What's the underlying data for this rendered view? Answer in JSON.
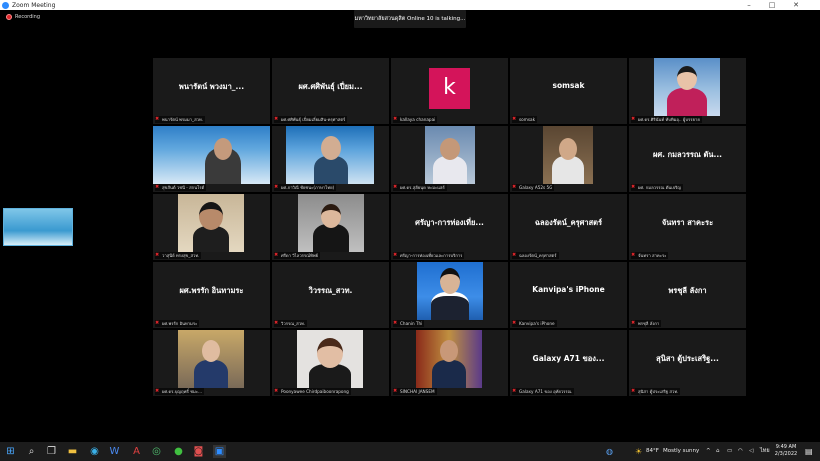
{
  "window": {
    "title": "Zoom Meeting",
    "controls": [
      "–",
      "□",
      "✕"
    ]
  },
  "recording_label": "Recording",
  "talking_banner": "มหาวิทยาลัยสวนดุสิต Online  10  is talking...",
  "tiles": [
    {
      "center_name": "พนารัตน์ พวงมา_...",
      "label": "พนารัตน์ พรมมา_สวท.",
      "muted": true
    },
    {
      "center_name": "ผศ.ศศิพันธุ์ เปี่ยม...",
      "label": "ผศ.ศศิพันธุ์ เปี่ยมเลี่ยมสิน-ครุศาสตร์",
      "muted": true
    },
    {
      "center_name": "",
      "label": "kallaya chanapai",
      "muted": true,
      "avatar_letter": "k",
      "avatar_color": "#d4145a"
    },
    {
      "center_name": "somsak",
      "label": "somsak",
      "muted": true
    },
    {
      "center_name": "",
      "label": "ผศ.ดร.ศิรินันท์ ทับทิมอุ.. ผู้บรรยาย",
      "muted": true
    },
    {
      "center_name": "",
      "label": "สุขสันต์ วชนี - สกนโรต์",
      "muted": true
    },
    {
      "center_name": "",
      "label": "ผศ.ภาวิณี ชัยชนะ(ภาษาไทย)",
      "muted": true
    },
    {
      "center_name": "",
      "label": "ผศ.ดร.สุฮัยนุด หะมะแฮร์",
      "muted": true
    },
    {
      "center_name": "",
      "label": "Galaxy A52s 5G",
      "muted": true
    },
    {
      "center_name": "ผศ. กมลวรรณ ตัน...",
      "label": "ผศ. กมลวรรณ ตันเจริญ",
      "muted": true
    },
    {
      "center_name": "",
      "label": "วาสุนีย์ ทรงสุข_สวท.",
      "muted": true
    },
    {
      "center_name": "",
      "label": "ศรีดา วิไลวรรณ์ทิพย์",
      "muted": true
    },
    {
      "center_name": "ศรัญา-การท่องเที่ย...",
      "label": "ศรัญา-การท่องเที่ยวและการบริการ",
      "muted": true
    },
    {
      "center_name": "ฉลองรัตน์_ครุศาสตร์",
      "label": "ฉลองรัตน์_ครุศาสตร์",
      "muted": true
    },
    {
      "center_name": "จันทรา  สาคะระ",
      "label": "จันทรา สาคะระ",
      "muted": true
    },
    {
      "center_name": "ผศ.พรรัก อินทามระ",
      "label": "ผศ.พรรัก อินทามระ",
      "muted": true
    },
    {
      "center_name": "วิวรรณ_สวท.",
      "label": "วิวรรณ_สวท.",
      "muted": true
    },
    {
      "center_name": "",
      "label": "Chanin Thi",
      "muted": true
    },
    {
      "center_name": "Kanvipa's iPhone",
      "label": "Kanvipa's iPhone",
      "muted": true
    },
    {
      "center_name": "พรชุลี ลังกา",
      "label": "พรชุลี ลังกา",
      "muted": true
    },
    {
      "center_name": "",
      "label": "ผศ.ดร.บุญฤทธิ์ ชมะ...",
      "muted": true
    },
    {
      "center_name": "",
      "label": "Poonyawee Chirdpaiboonrapong",
      "muted": true
    },
    {
      "center_name": "",
      "label": "SINCHAI JANSEM",
      "muted": true
    },
    {
      "center_name": "Galaxy A71 ของ...",
      "label": "Galaxy A71 ของ อุทัยวรรณ",
      "muted": true
    },
    {
      "center_name": "สุนิสา ตู้ประเสริฐ...",
      "label": "สุนิสา ตู้ประเสริฐ สวท.",
      "muted": true
    }
  ],
  "taskbar": {
    "weather_temp": "84°F",
    "weather_text": "Mostly sunny",
    "language": "ไทย",
    "time": "9:49 AM",
    "date": "2/3/2022"
  },
  "colors": {
    "tile_bg": "#1a1a1a",
    "taskbar_bg": "#1c1c1c",
    "zoom_blue": "#2d8cff",
    "mute_red": "#e0262b"
  }
}
